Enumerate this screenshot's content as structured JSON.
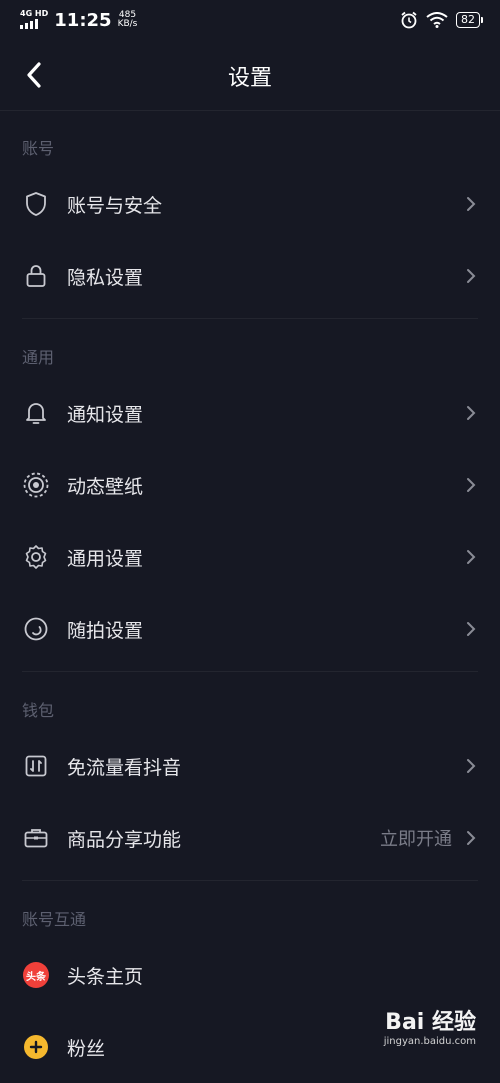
{
  "status_bar": {
    "network": "4G HD",
    "time": "11:25",
    "speed_value": "485",
    "speed_unit": "KB/s",
    "battery": "82"
  },
  "nav": {
    "title": "设置"
  },
  "sections": [
    {
      "header": "账号",
      "items": [
        {
          "label": "账号与安全",
          "icon": "shield-icon"
        },
        {
          "label": "隐私设置",
          "icon": "lock-icon"
        }
      ]
    },
    {
      "header": "通用",
      "items": [
        {
          "label": "通知设置",
          "icon": "bell-icon"
        },
        {
          "label": "动态壁纸",
          "icon": "wallpaper-icon"
        },
        {
          "label": "通用设置",
          "icon": "gear-icon"
        },
        {
          "label": "随拍设置",
          "icon": "snapshot-icon"
        }
      ]
    },
    {
      "header": "钱包",
      "items": [
        {
          "label": "免流量看抖音",
          "icon": "data-plan-icon"
        },
        {
          "label": "商品分享功能",
          "icon": "briefcase-icon",
          "value": "立即开通"
        }
      ]
    },
    {
      "header": "账号互通",
      "items": [
        {
          "label": "头条主页",
          "icon": "toutiao-icon",
          "badge": "头条"
        },
        {
          "label": "粉丝",
          "icon": "fans-icon"
        }
      ]
    }
  ],
  "watermark": {
    "brand": "Bai 经验",
    "url": "jingyan.baidu.com"
  }
}
